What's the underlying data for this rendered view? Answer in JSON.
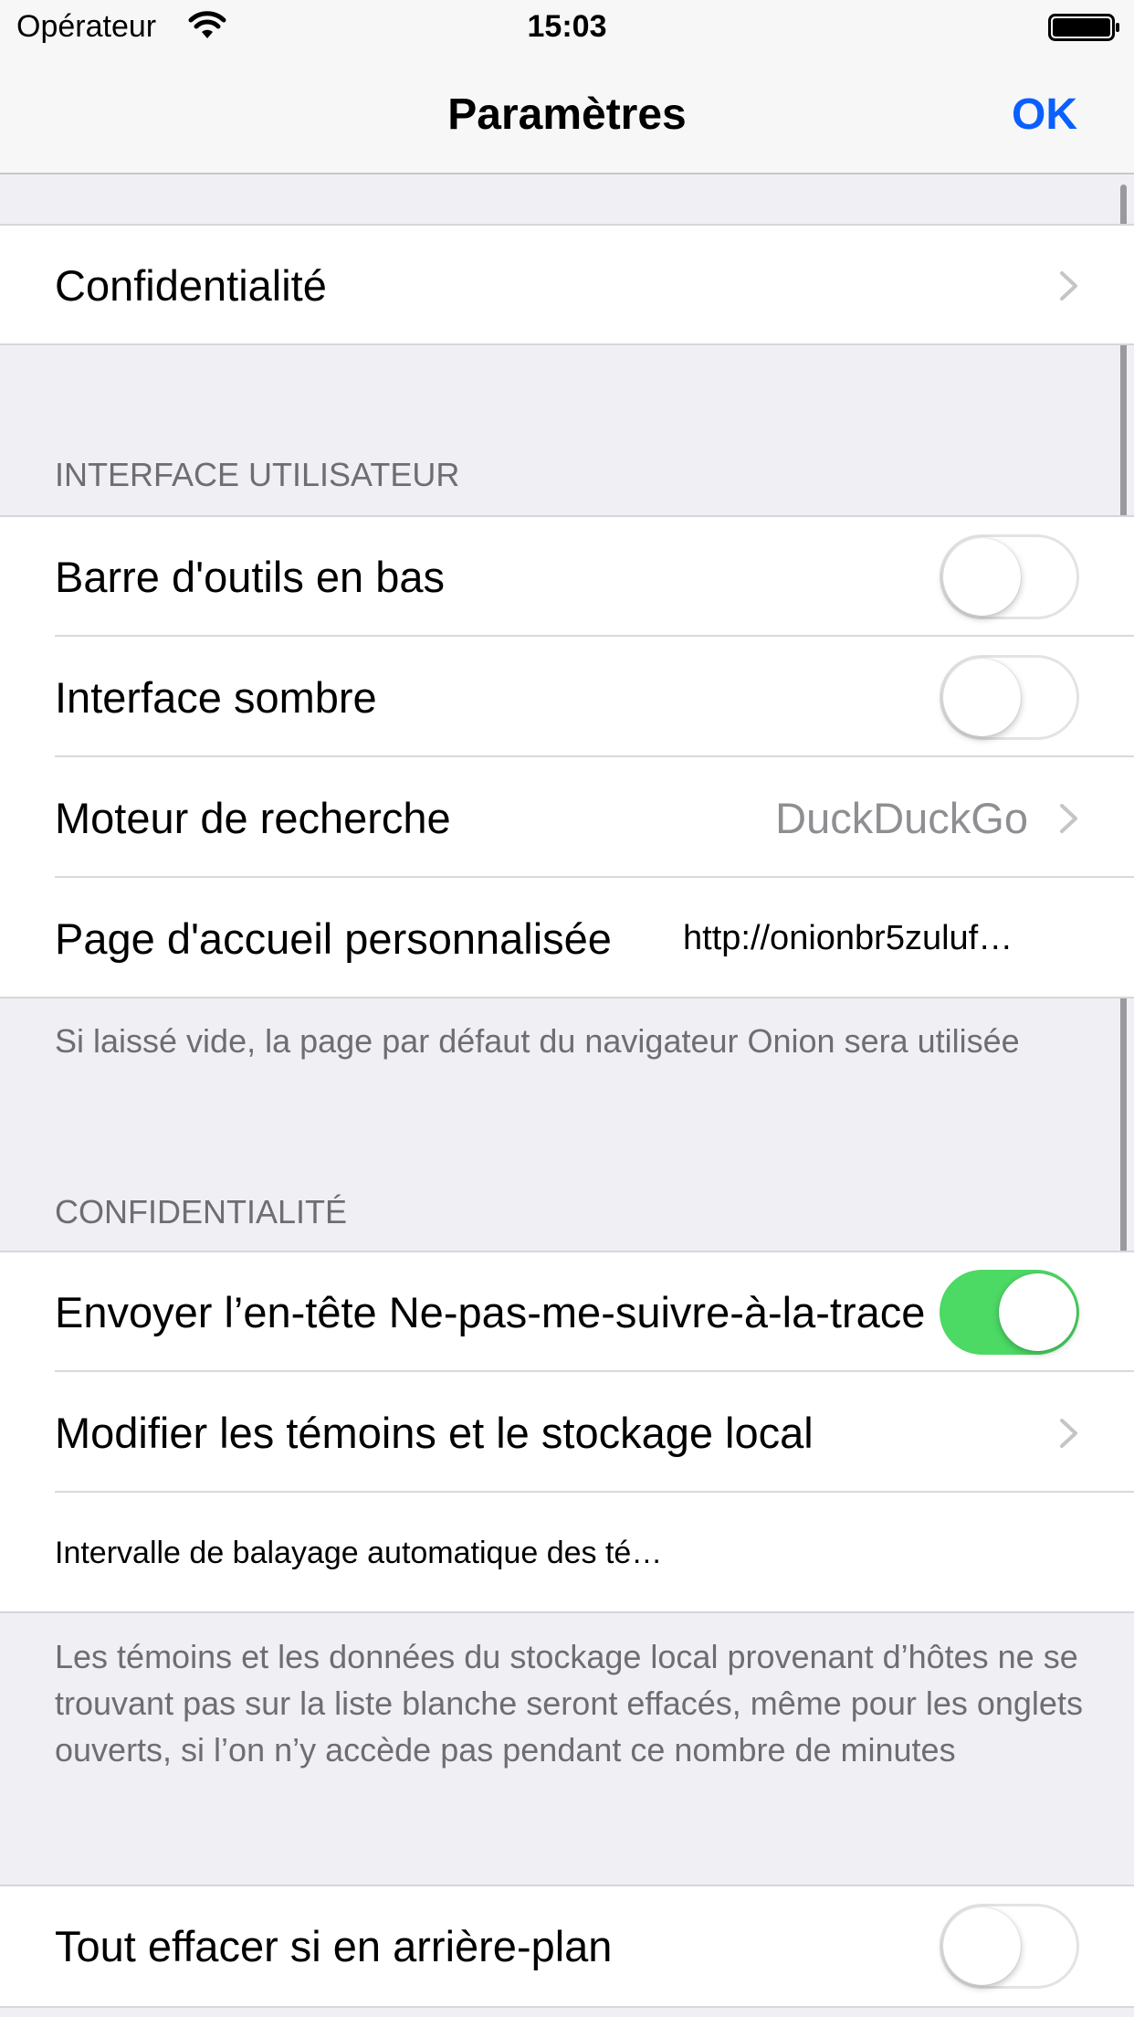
{
  "status_bar": {
    "carrier": "Opérateur",
    "time": "15:03"
  },
  "nav": {
    "title": "Paramètres",
    "done_label": "OK"
  },
  "section_privacy_link": {
    "label": "Confidentialité"
  },
  "section_ui": {
    "header": "INTERFACE UTILISATEUR",
    "rows": {
      "bottom_toolbar": {
        "label": "Barre d'outils en bas",
        "on": false
      },
      "dark_interface": {
        "label": "Interface sombre",
        "on": false
      },
      "search_engine": {
        "label": "Moteur de recherche",
        "value": "DuckDuckGo"
      },
      "homepage": {
        "label": "Page d'accueil personnalisée",
        "value": "http://onionbr5zuluf…"
      }
    },
    "footer": "Si laissé vide, la page par défaut du navigateur Onion sera utilisée"
  },
  "section_privacy": {
    "header": "CONFIDENTIALITÉ",
    "rows": {
      "dnt": {
        "label": "Envoyer l’en-tête Ne-pas-me-suivre-à-la-trace",
        "on": true
      },
      "cookies": {
        "label": "Modifier les témoins et le stockage local"
      },
      "sweep_interval": {
        "label": "Intervalle de balayage automatique des té…"
      }
    },
    "footer": "Les témoins et les données du stockage local provenant d’hôtes ne se trouvant pas sur la liste blanche seront effacés, même pour les onglets ouverts, si l’on n’y accède pas pendant ce nombre de minutes"
  },
  "section_clear": {
    "rows": {
      "clear_background": {
        "label": "Tout effacer si en arrière-plan",
        "on": false
      }
    }
  },
  "colors": {
    "accent": "#0a60ff",
    "toggle_on": "#4cd964",
    "background": "#efeff4"
  },
  "icons": {
    "wifi": "wifi-icon",
    "battery": "battery-icon",
    "chevron": "chevron-right-icon"
  }
}
